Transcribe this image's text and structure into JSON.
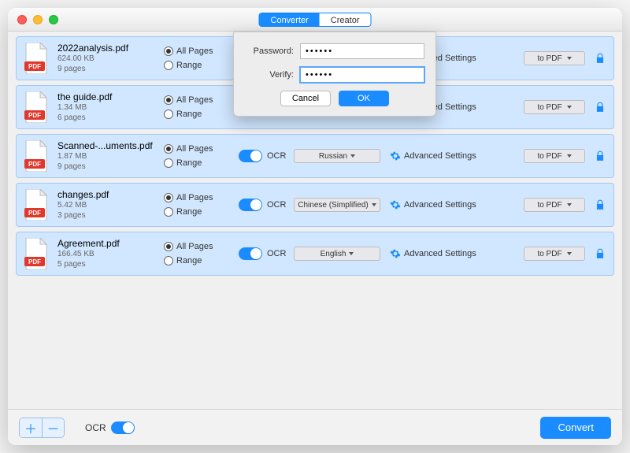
{
  "header": {
    "tabs": {
      "converter": "Converter",
      "creator": "Creator"
    }
  },
  "labels": {
    "all_pages": "All Pages",
    "range": "Range",
    "ocr": "OCR",
    "advanced": "Advanced Settings",
    "to_pdf": "to PDF"
  },
  "files": [
    {
      "name": "2022analysis.pdf",
      "size": "624.00 KB",
      "pages": "9 pages",
      "lang": ""
    },
    {
      "name": "the guide.pdf",
      "size": "1.34 MB",
      "pages": "6 pages",
      "lang": ""
    },
    {
      "name": "Scanned-...uments.pdf",
      "size": "1.87 MB",
      "pages": "9 pages",
      "lang": "Russian"
    },
    {
      "name": "changes.pdf",
      "size": "5.42 MB",
      "pages": "3 pages",
      "lang": "Chinese (Simplified)"
    },
    {
      "name": "Agreement.pdf",
      "size": "166.45 KB",
      "pages": "5 pages",
      "lang": "English"
    }
  ],
  "modal": {
    "password_label": "Password:",
    "verify_label": "Verify:",
    "password_value": "••••••",
    "verify_value": "••••••",
    "cancel": "Cancel",
    "ok": "OK"
  },
  "footer": {
    "ocr": "OCR",
    "convert": "Convert"
  }
}
